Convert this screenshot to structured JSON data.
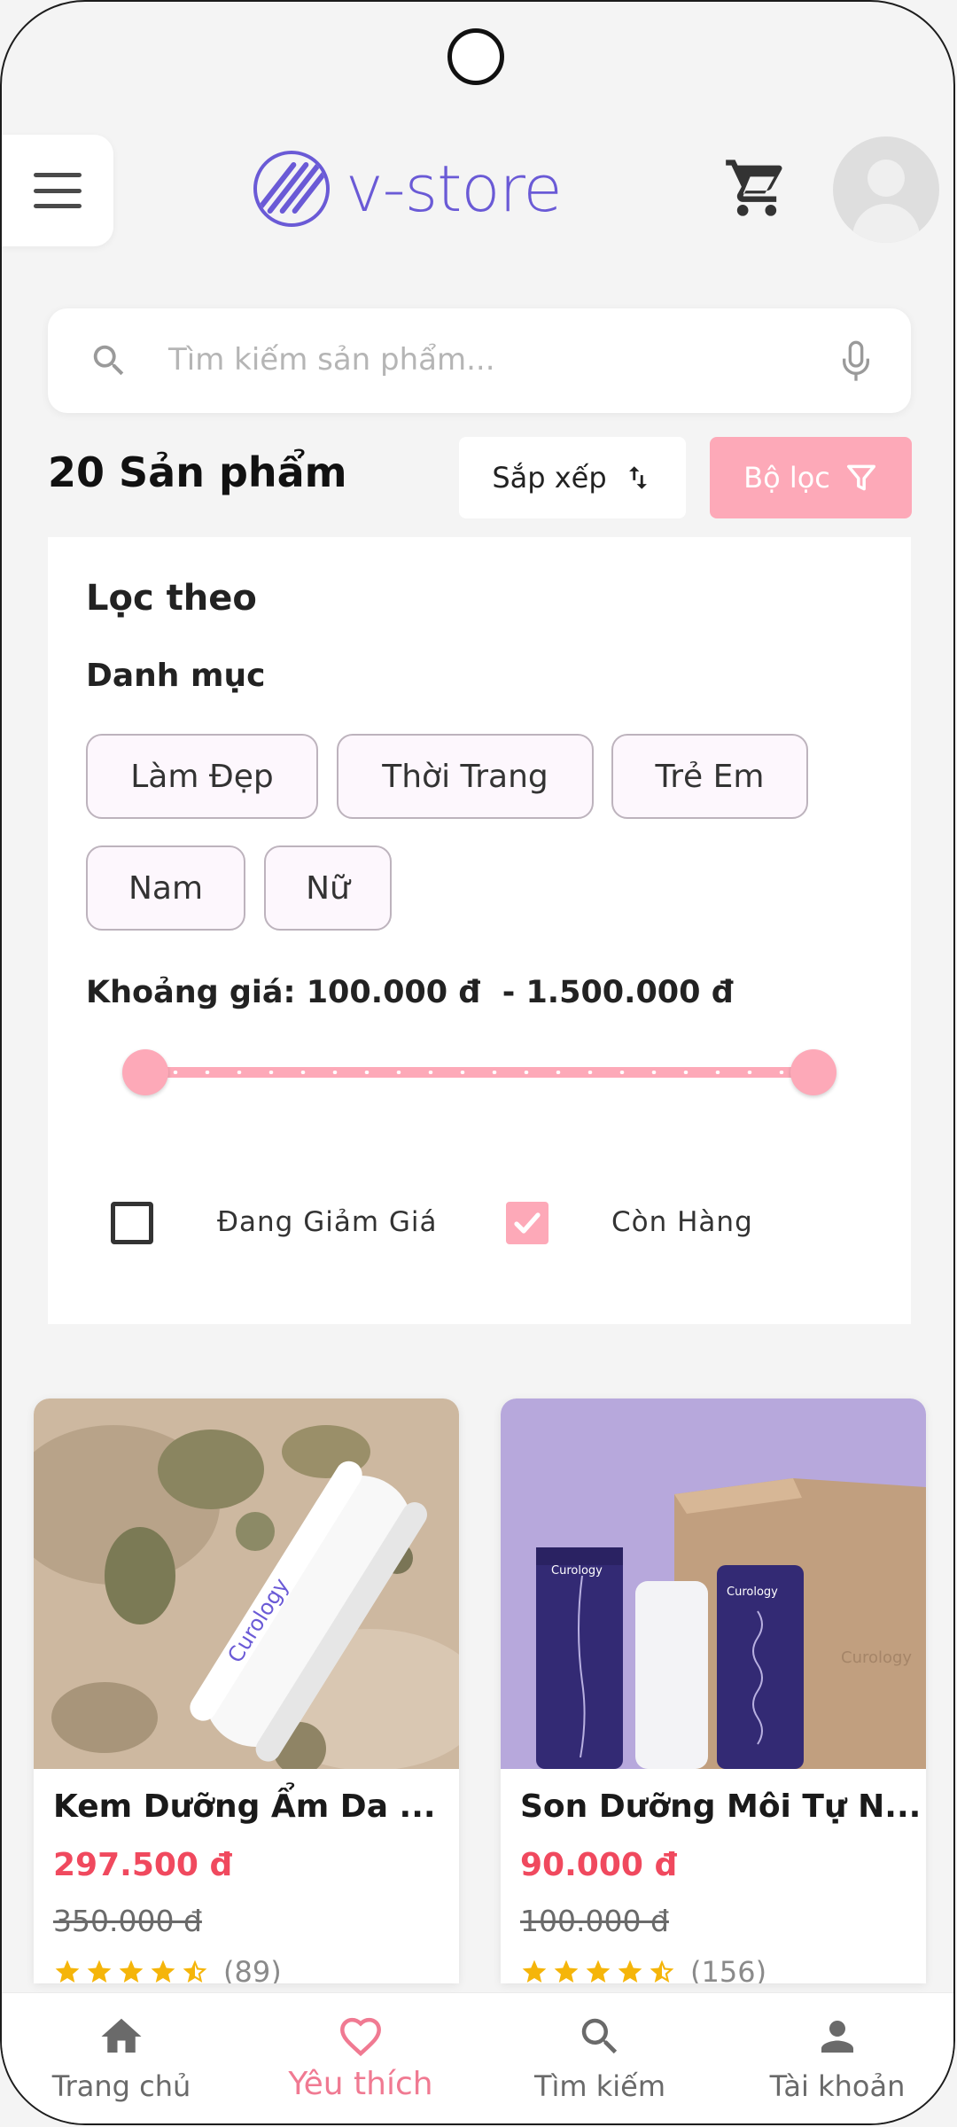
{
  "app": {
    "logo_text": "v-store",
    "brand_color": "#6a5ad6",
    "accent_color": "#fda9b8",
    "price_color": "#f0495e"
  },
  "header": {
    "menu_icon": "menu-icon",
    "cart_icon": "cart-icon",
    "avatar_icon": "avatar-icon"
  },
  "search": {
    "placeholder": "Tìm kiếm sản phẩm...",
    "icon": "search-icon",
    "mic_icon": "mic-icon"
  },
  "toolbar": {
    "count_label": "20 Sản phẩm",
    "sort_label": "Sắp xếp",
    "sort_icon": "sort-icon",
    "filter_label": "Bộ lọc",
    "filter_icon": "filter-icon"
  },
  "filter_panel": {
    "title": "Lọc theo",
    "category_label": "Danh mục",
    "categories": [
      "Làm Đẹp",
      "Thời Trang",
      "Trẻ Em",
      "Nam",
      "Nữ"
    ],
    "price_label": "Khoảng giá: 100.000 đ  - 1.500.000 đ",
    "price_min": "100.000 đ",
    "price_max": "1.500.000 đ",
    "slider_range": [
      0,
      1
    ],
    "checkboxes": [
      {
        "label": "Đang Giảm Giá",
        "checked": false
      },
      {
        "label": "Còn Hàng",
        "checked": true
      }
    ]
  },
  "products": [
    {
      "name": "Kem Dưỡng Ẩm Da ...",
      "price": "297.500 đ",
      "old_price": "350.000 đ",
      "rating": 4.5,
      "reviews": "(89)",
      "image_brand": "Curology"
    },
    {
      "name": "Son Dưỡng Môi Tự N...",
      "price": "90.000 đ",
      "old_price": "100.000 đ",
      "rating": 4.5,
      "reviews": "(156)",
      "image_brand": "Curology"
    }
  ],
  "bottom_nav": [
    {
      "label": "Trang chủ",
      "icon": "home-icon",
      "active": false
    },
    {
      "label": "Yêu thích",
      "icon": "heart-icon",
      "active": true
    },
    {
      "label": "Tìm kiếm",
      "icon": "search-icon",
      "active": false
    },
    {
      "label": "Tài khoản",
      "icon": "account-icon",
      "active": false
    }
  ]
}
